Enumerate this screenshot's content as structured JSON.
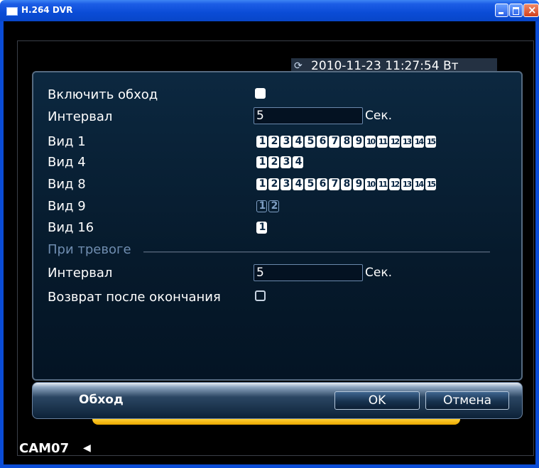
{
  "window": {
    "title": "H.264 DVR"
  },
  "osd": {
    "datetime": "2010-11-23 11:27:54 Вт",
    "camera_name": "CAM07"
  },
  "form": {
    "enable_tour_label": "Включить обход",
    "enable_tour_checked": true,
    "interval_label": "Интервал",
    "interval_value": "5",
    "interval_unit": "Сек.",
    "views": [
      {
        "label": "Вид 1",
        "channels": [
          "1",
          "2",
          "3",
          "4",
          "5",
          "6",
          "7",
          "8",
          "9",
          "10",
          "11",
          "12",
          "13",
          "14",
          "15"
        ],
        "style": "filled"
      },
      {
        "label": "Вид 4",
        "channels": [
          "1",
          "2",
          "3",
          "4"
        ],
        "style": "filled"
      },
      {
        "label": "Вид 8",
        "channels": [
          "1",
          "2",
          "3",
          "4",
          "5",
          "6",
          "7",
          "8",
          "9",
          "10",
          "11",
          "12",
          "13",
          "14",
          "15"
        ],
        "style": "filled"
      },
      {
        "label": "Вид 9",
        "channels": [
          "1",
          "2"
        ],
        "style": "outline"
      },
      {
        "label": "Вид 16",
        "channels": [
          "1"
        ],
        "style": "filled"
      }
    ],
    "alarm_section_label": "При тревоге",
    "alarm_interval_label": "Интервал",
    "alarm_interval_value": "5",
    "alarm_interval_unit": "Сек.",
    "return_after_label": "Возврат после окончания",
    "return_after_checked": false
  },
  "footer": {
    "title": "Обход",
    "ok_label": "OK",
    "cancel_label": "Отмена"
  },
  "colors": {
    "titlebar": "#0a4cd6",
    "dialog_bg": "#0c2840",
    "accent_yellow": "#ffcf33"
  }
}
